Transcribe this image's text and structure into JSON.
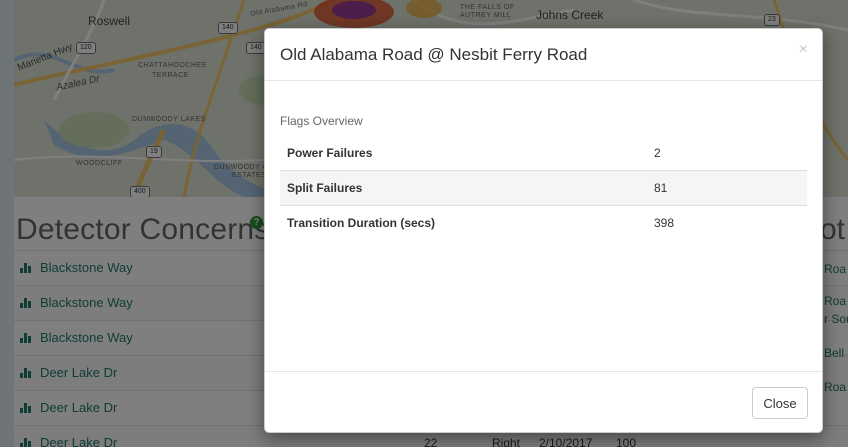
{
  "map": {
    "labels": {
      "roswell": "Roswell",
      "johns_creek": "Johns Creek",
      "marietta_hwy": "Marietta Hwy",
      "azalea_dr": "Azalea Dr",
      "chattahoochee": "CHATTAHOOCHEE",
      "terrace": "TERRACE",
      "dunwoody_lakes": "DUNWOODY LAKES",
      "woodcliff": "WOODCLIFF",
      "dunwoody_c": "DUNWOODY C",
      "estates": "ESTATES",
      "falls_of": "THE FALLS OF",
      "autrey_mill": "AUTREY MILL",
      "old_alabama_rd": "Old Alabama Rd"
    },
    "shields": {
      "s140a": "140",
      "s140b": "140",
      "s120": "120",
      "s23": "23",
      "s19": "19",
      "s400": "400"
    }
  },
  "detector_concerns": {
    "title": "Detector Concerns",
    "help_icon": "?",
    "rows": [
      {
        "name": "Blackstone Way"
      },
      {
        "name": "Blackstone Way"
      },
      {
        "name": "Blackstone Way"
      },
      {
        "name": "Deer Lake Dr"
      },
      {
        "name": "Deer Lake Dr"
      },
      {
        "name": "Deer Lake Dr",
        "c1": "22",
        "c2": "Right",
        "c3": "2/10/2017",
        "c4": "100"
      }
    ]
  },
  "right_panel": {
    "title": "ot",
    "links": [
      "Roa",
      "Roa",
      "r Sou",
      "Bell",
      "Roa"
    ]
  },
  "modal": {
    "title": "Old Alabama Road @ Nesbit Ferry Road",
    "close_symbol": "×",
    "flags_label": "Flags Overview",
    "flags": [
      {
        "key": "Power Failures",
        "value": "2"
      },
      {
        "key": "Split Failures",
        "value": "81"
      },
      {
        "key": "Transition Duration (secs)",
        "value": "398"
      }
    ],
    "close_button": "Close"
  },
  "icons": {
    "chart": "bar-chart-icon",
    "help": "question-circle-icon",
    "close": "close-icon"
  },
  "colors": {
    "link": "#1f7a6a",
    "help_badge": "#2e9a3a"
  }
}
